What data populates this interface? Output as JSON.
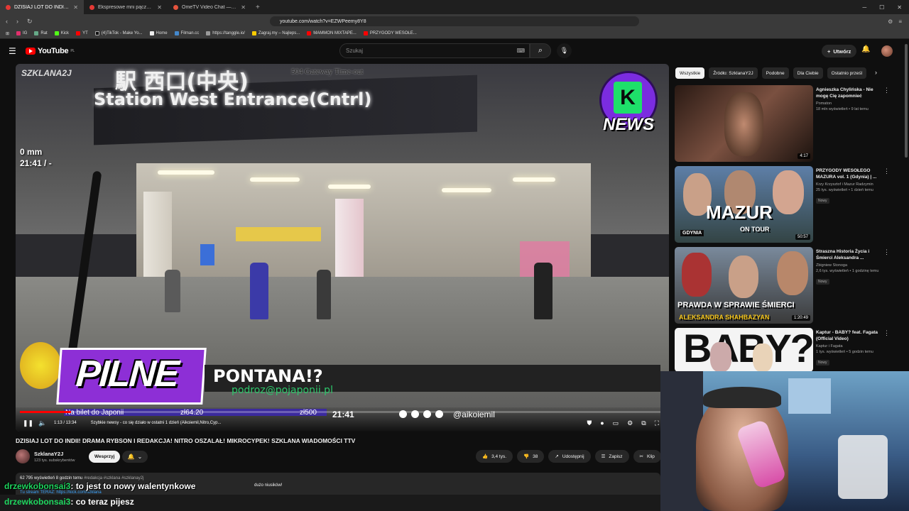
{
  "browser": {
    "tabs": [
      {
        "title": "DZISIAJ LOT DO INDII! DRAM",
        "active": true
      },
      {
        "title": "Ekspresowe mni pączki - łyżka ładna"
      },
      {
        "title": "OmeTV Video Chat — Omegle Rand"
      }
    ],
    "url": "youtube.com/watch?v=EZWPeemy8Y8",
    "bookmarks": [
      "IG",
      "Rat",
      "Kick",
      "YT",
      "(4)TikTok - Make Yo...",
      "Home",
      "Filman.cc",
      "https://tanggle.io/",
      "Zagraj.my – Najleps...",
      "MAMMON MIXTAPE...",
      "PRZYGODY WESOŁE..."
    ]
  },
  "youtube": {
    "logo": "YouTube",
    "region": "PL",
    "search_placeholder": "Szukaj",
    "create_label": "Utwórz"
  },
  "video": {
    "watermark": "SZKLANA2J",
    "gateway_error": "504 Gateway Time-out",
    "measure": "0 mm",
    "clock": "21:41 / -",
    "news_logo": "NEWS",
    "pilne": "PILNE",
    "lower_title": "PONTANA!?",
    "lower_email": "podroz@pojaponii.pl",
    "ticker_text": "Na bilet do Japonii",
    "ticker_price1": "zł64.20",
    "ticker_price2": "zł500",
    "ticker_time": "21:41",
    "handle": "@aikoiemil",
    "time": "1:13 / 13:34",
    "chapter": "Szybkie newsy - co się działo w ostatni 1 dzień (Aikoiemil,Nitro,Cyp...",
    "progress": 0.08
  },
  "meta": {
    "title": "DZISIAJ LOT DO INDII! DRAMA RYBSON I REDAKCJA! NITRO OSZALAŁ! MIKROCYPEK! SZKLANA WIADOMOŚCI TTV",
    "channel": "SzklanaY2J",
    "subs": "123 tys. subskrybentów",
    "support": "Wesprzyj",
    "likes": "3,4 tys.",
    "dislikes": "38",
    "share": "Udostępnij",
    "save": "Zapisz",
    "clip": "Klip",
    "views": "62 795 wyświetleń  8 godzin temu",
    "tags": "#redakcja #szklana #szklanay2j",
    "desc2": "dużo niusików!",
    "desc3": "Tu stream TERAZ: https://kick.com/szklana"
  },
  "chat": [
    {
      "user": "drzewkobonsai3",
      "text": ": to jest to nowy walentynkowe"
    },
    {
      "user": "drzewkobonsai3",
      "text": ": co teraz pijesz"
    }
  ],
  "chips": [
    "Wszystkie",
    "Źródło: SzklanaY2J",
    "Podobne",
    "Dla Ciebie",
    "Ostatnio prześl"
  ],
  "recommendations": [
    {
      "title": "Agnieszka Chylińska - Nie mogę Cię zapomnieć",
      "channel": "Pomaton",
      "meta": "18 mln wyświetleń • 9 lat temu",
      "duration": "4:17",
      "badge": ""
    },
    {
      "title": "PRZYGODY WESOŁEGO MAZURA vol. 1 (Gdynia) | ...",
      "channel": "Krzy Krzysztof i Mazur Radzymin",
      "meta": "25 tys. wyświetleń • 1 dzień temu",
      "duration": "50:57",
      "badge": "Nowy",
      "thumb_text": "MAZUR",
      "thumb_sub": "ON TOUR",
      "thumb_city": "GDYNIA"
    },
    {
      "title": "Straszna Historia Życia i Śmierci Aleksandra ...",
      "channel": "Zbigniew Stonoga",
      "meta": "2,6 tys. wyświetleń • 1 godzinę temu",
      "duration": "1:20:49",
      "badge": "Nowy",
      "thumb_text": "PRAWDA W SPRAWIE ŚMIERCI",
      "thumb_sub": "ALEKSANDRA SHAHBAZYAN"
    },
    {
      "title": "Kaptur - BABY? feat. Fagata (Official Video)",
      "channel": "Kaptur i Fagata",
      "meta": "1 tys. wyświetleń • 5 godzin temu",
      "duration": "",
      "badge": "Nowy",
      "thumb_text": "BABY?"
    }
  ],
  "colors": {
    "accent": "#ff0000",
    "chat_user": "#1fd65f",
    "pilne": "#8d2fd6"
  }
}
